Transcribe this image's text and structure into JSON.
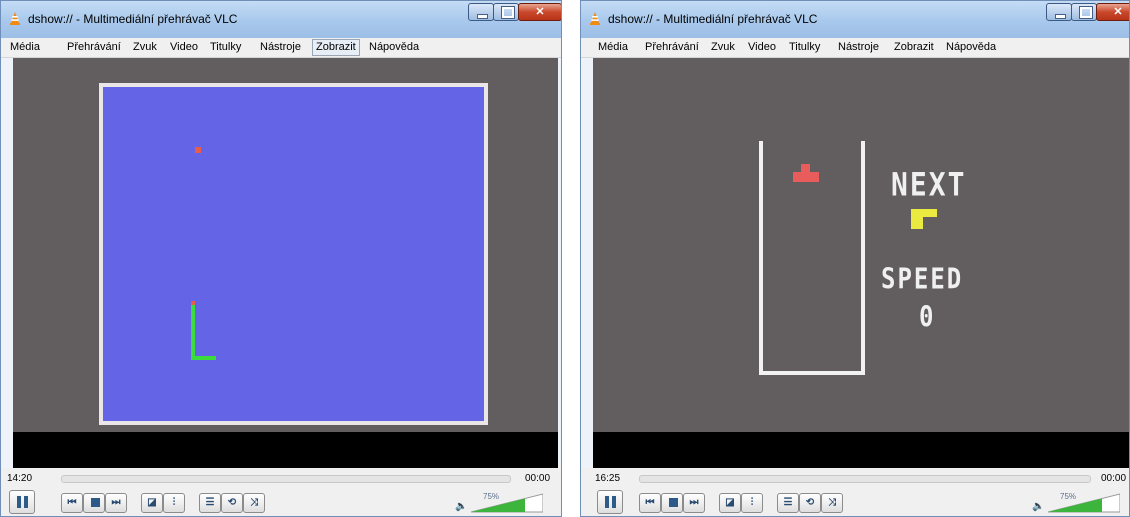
{
  "windows": [
    {
      "title": "dshow:// - Multimediální přehrávač VLC",
      "menu": [
        "Média",
        "Přehrávání",
        "Zvuk",
        "Video",
        "Titulky",
        "Nástroje",
        "Zobrazit",
        "Nápověda"
      ],
      "active_menu": "Zobrazit",
      "time_elapsed": "14:20",
      "time_remaining": "00:00",
      "volume_percent": "75%",
      "game": "snake"
    },
    {
      "title": "dshow:// - Multimediální přehrávač VLC",
      "menu": [
        "Média",
        "Přehrávání",
        "Zvuk",
        "Video",
        "Titulky",
        "Nástroje",
        "Zobrazit",
        "Nápověda"
      ],
      "active_menu": "",
      "time_elapsed": "16:25",
      "time_remaining": "00:00",
      "volume_percent": "75%",
      "game": "tetris",
      "next_label": "NEXT",
      "speed_label": "SPEED",
      "speed_value": "0"
    }
  ],
  "colors": {
    "video_bg": "#625e5f",
    "snake_field": "#6464e6",
    "snake_body": "#3ddc3d",
    "food": "#e85c4e",
    "piece_red": "#e85c5c",
    "piece_yellow": "#eaea40",
    "volume_green": "#3db53d"
  },
  "icons": [
    "vlc-cone-icon",
    "minimize-icon",
    "maximize-icon",
    "close-icon",
    "pause-icon",
    "previous-icon",
    "stop-icon",
    "next-icon",
    "fullscreen-icon",
    "extended-settings-icon",
    "playlist-icon",
    "loop-icon",
    "shuffle-icon",
    "speaker-icon"
  ]
}
